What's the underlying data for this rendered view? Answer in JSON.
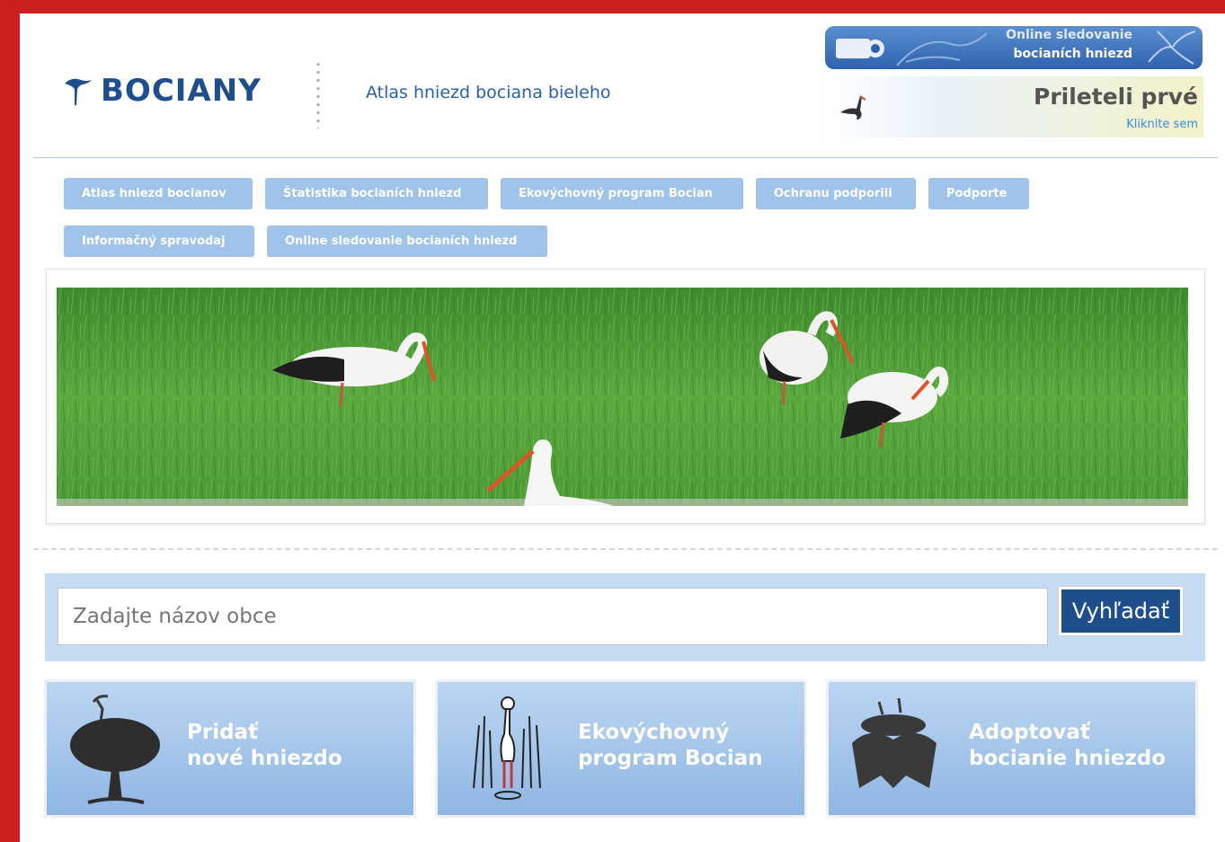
{
  "header": {
    "logo_text": "BOCIANY",
    "tagline": "Atlas hniezd bociana bieleho",
    "online_banner": {
      "line1": "Online sledovanie",
      "line2": "bocianích hniezd"
    },
    "first_banner": {
      "title": "Prileteli prvé",
      "link": "Kliknite sem"
    }
  },
  "nav": {
    "items": [
      "Atlas hniezd bocianov",
      "Štatistika bocianích hniezd",
      "Ekovýchovný program Bocian",
      "Ochranu podporili",
      "Podporte",
      "Informačný spravodaj",
      "Online sledovanie bocianích hniezd"
    ]
  },
  "search": {
    "placeholder": "Zadajte názov obce",
    "button_label": "Vyhľadať"
  },
  "tiles": [
    {
      "line1": "Pridať",
      "line2": "nové hniezdo"
    },
    {
      "line1": "Ekovýchovný",
      "line2": "program Bocian"
    },
    {
      "line1": "Adoptovať",
      "line2": "bocianie hniezdo"
    }
  ],
  "colors": {
    "frame": "#cc1f1f",
    "brand": "#1f4e8c",
    "nav": "#9fc3e9",
    "panel": "#c5dbf2"
  }
}
